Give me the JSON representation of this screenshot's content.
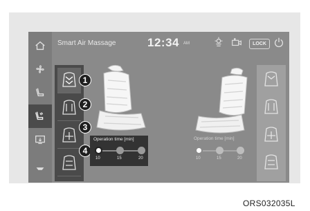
{
  "header": {
    "title": "Smart Air Massage",
    "time": "12:34",
    "ampm": "AM",
    "lock_label": "LOCK"
  },
  "sidebar": {
    "items": [
      {
        "name": "home",
        "icon": "home-icon"
      },
      {
        "name": "fan",
        "icon": "fan-icon"
      },
      {
        "name": "seat-heat",
        "icon": "seat-icon"
      },
      {
        "name": "massage",
        "icon": "massage-seat-icon",
        "active": true
      },
      {
        "name": "screen",
        "icon": "screen-icon"
      },
      {
        "name": "more",
        "icon": "more-icon"
      }
    ]
  },
  "left_modes": {
    "callouts": [
      "1",
      "2",
      "3",
      "4"
    ],
    "active_index": 0
  },
  "operation_time": {
    "label": "Operation time [min]",
    "options": [
      "10",
      "15",
      "20"
    ],
    "selected": "10"
  },
  "right_operation_time": {
    "label": "Operation time [min]",
    "options": [
      "10",
      "15",
      "20"
    ],
    "selected": "10"
  },
  "figure_code": "ORS032035L",
  "colors": {
    "screen_bg": "#8a8a8a",
    "panel_dark": "#4a4a4a",
    "callout_bg": "#1f1f1f"
  }
}
